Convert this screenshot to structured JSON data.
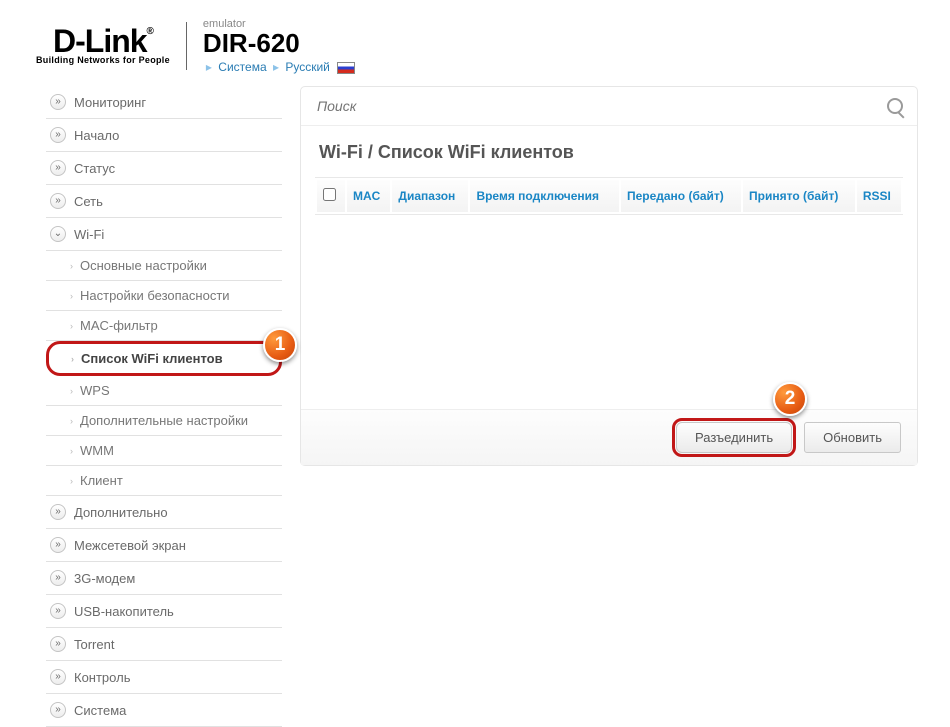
{
  "header": {
    "brand_main": "D-Link",
    "brand_sup": "®",
    "brand_tagline": "Building Networks for People",
    "emulator_label": "emulator",
    "model": "DIR-620",
    "crumb_system": "Система",
    "crumb_lang": "Русский"
  },
  "sidebar": {
    "items": [
      {
        "label": "Мониторинг",
        "expanded": false
      },
      {
        "label": "Начало",
        "expanded": false
      },
      {
        "label": "Статус",
        "expanded": false
      },
      {
        "label": "Сеть",
        "expanded": false
      },
      {
        "label": "Wi-Fi",
        "expanded": true,
        "children": [
          {
            "label": "Основные настройки"
          },
          {
            "label": "Настройки безопасности"
          },
          {
            "label": "MAC-фильтр"
          },
          {
            "label": "Список WiFi клиентов",
            "active": true
          },
          {
            "label": "WPS"
          },
          {
            "label": "Дополнительные настройки"
          },
          {
            "label": "WMM"
          },
          {
            "label": "Клиент"
          }
        ]
      },
      {
        "label": "Дополнительно",
        "expanded": false
      },
      {
        "label": "Межсетевой экран",
        "expanded": false
      },
      {
        "label": "3G-модем",
        "expanded": false
      },
      {
        "label": "USB-накопитель",
        "expanded": false
      },
      {
        "label": "Torrent",
        "expanded": false
      },
      {
        "label": "Контроль",
        "expanded": false
      },
      {
        "label": "Система",
        "expanded": false
      }
    ]
  },
  "search": {
    "placeholder": "Поиск"
  },
  "page": {
    "title": "Wi-Fi /  Список WiFi клиентов",
    "columns": [
      "MAC",
      "Диапазон",
      "Время подключения",
      "Передано (байт)",
      "Принято (байт)",
      "RSSI"
    ]
  },
  "buttons": {
    "disconnect": "Разъединить",
    "refresh": "Обновить"
  },
  "annotations": {
    "badge1": "1",
    "badge2": "2"
  }
}
